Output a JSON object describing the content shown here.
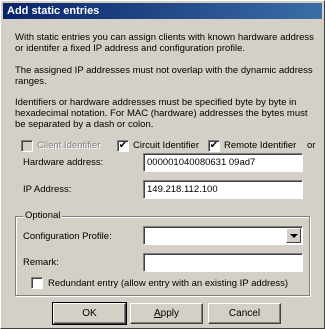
{
  "window": {
    "title": "Add static entries"
  },
  "intro": {
    "para1": "With static entries you can assign clients with known hardware address or identifer a fixed IP address and configuration profile.",
    "para2": "The assigned IP addresses must not overlap with the dynamic address ranges.",
    "para3": "Identifiers or hardware addresses must be specified byte by byte in hexadecimal notation. For MAC (hardware) addresses the bytes must be separated by a dash or colon."
  },
  "identifier_options": {
    "client_identifier": {
      "label": "Client Identifier",
      "checked": false,
      "enabled": false
    },
    "circuit_identifier": {
      "label": "Circuit Identifier",
      "checked": true,
      "enabled": true
    },
    "remote_identifier": {
      "label": "Remote Identifier",
      "checked": true,
      "enabled": true
    },
    "or_label": "or"
  },
  "hardware_address": {
    "label": "Hardware address:",
    "value": "000001040080631 09ad7"
  },
  "ip_address": {
    "label": "IP Address:",
    "value": "149.218.112.100"
  },
  "optional": {
    "legend": "Optional",
    "configuration_profile": {
      "label": "Configuration Profile:",
      "value": ""
    },
    "remark": {
      "label": "Remark:",
      "value": ""
    },
    "redundant_entry": {
      "label": "Redundant entry (allow entry with an existing IP address)",
      "checked": false
    }
  },
  "buttons": {
    "ok": "OK",
    "apply": "Apply",
    "cancel": "Cancel"
  },
  "check_mark": "✔"
}
